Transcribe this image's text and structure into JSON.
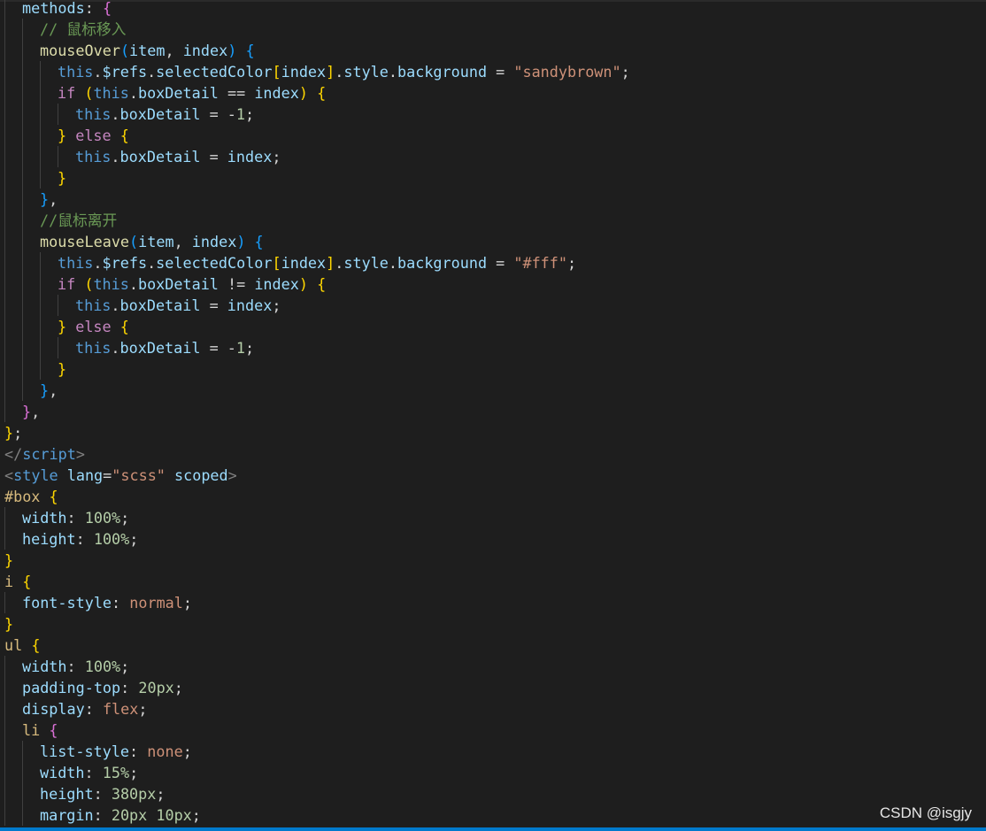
{
  "editor": {
    "language": "vue",
    "theme": "dark",
    "colors": {
      "background": "#1e1e1e",
      "default_text": "#d4d4d4",
      "keyword": "#c586c0",
      "this_keyword": "#569cd6",
      "function": "#dcdcaa",
      "property": "#9cdcfe",
      "string": "#ce9178",
      "number": "#b5cea8",
      "comment": "#6a9955",
      "selector": "#d7ba7d",
      "bracket_level1": "#ffd700",
      "bracket_level2": "#da70d6",
      "bracket_level3": "#179fff",
      "indent_guide": "#404040",
      "status_bar": "#007acc"
    },
    "lines": [
      {
        "indent": 1,
        "tokens": [
          [
            "prop",
            "methods"
          ],
          [
            "pun",
            ": "
          ],
          [
            "b2",
            "{"
          ]
        ]
      },
      {
        "indent": 2,
        "tokens": [
          [
            "cmt",
            "// 鼠标移入"
          ]
        ]
      },
      {
        "indent": 2,
        "tokens": [
          [
            "fn",
            "mouseOver"
          ],
          [
            "b3",
            "("
          ],
          [
            "prop",
            "item"
          ],
          [
            "pun",
            ", "
          ],
          [
            "prop",
            "index"
          ],
          [
            "b3",
            ")"
          ],
          [
            "pun",
            " "
          ],
          [
            "b3",
            "{"
          ]
        ]
      },
      {
        "indent": 3,
        "tokens": [
          [
            "kwb",
            "this"
          ],
          [
            "pun",
            "."
          ],
          [
            "prop",
            "$refs"
          ],
          [
            "pun",
            "."
          ],
          [
            "prop",
            "selectedColor"
          ],
          [
            "b1",
            "["
          ],
          [
            "prop",
            "index"
          ],
          [
            "b1",
            "]"
          ],
          [
            "pun",
            "."
          ],
          [
            "prop",
            "style"
          ],
          [
            "pun",
            "."
          ],
          [
            "prop",
            "background"
          ],
          [
            "pun",
            " = "
          ],
          [
            "str",
            "\"sandybrown\""
          ],
          [
            "pun",
            ";"
          ]
        ]
      },
      {
        "indent": 3,
        "tokens": [
          [
            "kw",
            "if"
          ],
          [
            "pun",
            " "
          ],
          [
            "b1",
            "("
          ],
          [
            "kwb",
            "this"
          ],
          [
            "pun",
            "."
          ],
          [
            "prop",
            "boxDetail"
          ],
          [
            "pun",
            " == "
          ],
          [
            "prop",
            "index"
          ],
          [
            "b1",
            ")"
          ],
          [
            "pun",
            " "
          ],
          [
            "b1",
            "{"
          ]
        ]
      },
      {
        "indent": 4,
        "tokens": [
          [
            "kwb",
            "this"
          ],
          [
            "pun",
            "."
          ],
          [
            "prop",
            "boxDetail"
          ],
          [
            "pun",
            " = "
          ],
          [
            "pun",
            "-"
          ],
          [
            "num",
            "1"
          ],
          [
            "pun",
            ";"
          ]
        ]
      },
      {
        "indent": 3,
        "tokens": [
          [
            "b1",
            "}"
          ],
          [
            "pun",
            " "
          ],
          [
            "kw",
            "else"
          ],
          [
            "pun",
            " "
          ],
          [
            "b1",
            "{"
          ]
        ]
      },
      {
        "indent": 4,
        "tokens": [
          [
            "kwb",
            "this"
          ],
          [
            "pun",
            "."
          ],
          [
            "prop",
            "boxDetail"
          ],
          [
            "pun",
            " = "
          ],
          [
            "prop",
            "index"
          ],
          [
            "pun",
            ";"
          ]
        ]
      },
      {
        "indent": 3,
        "tokens": [
          [
            "b1",
            "}"
          ]
        ]
      },
      {
        "indent": 2,
        "tokens": [
          [
            "b3",
            "}"
          ],
          [
            "pun",
            ","
          ]
        ]
      },
      {
        "indent": 2,
        "tokens": [
          [
            "cmt",
            "//鼠标离开"
          ]
        ]
      },
      {
        "indent": 2,
        "tokens": [
          [
            "fn",
            "mouseLeave"
          ],
          [
            "b3",
            "("
          ],
          [
            "prop",
            "item"
          ],
          [
            "pun",
            ", "
          ],
          [
            "prop",
            "index"
          ],
          [
            "b3",
            ")"
          ],
          [
            "pun",
            " "
          ],
          [
            "b3",
            "{"
          ]
        ]
      },
      {
        "indent": 3,
        "tokens": [
          [
            "kwb",
            "this"
          ],
          [
            "pun",
            "."
          ],
          [
            "prop",
            "$refs"
          ],
          [
            "pun",
            "."
          ],
          [
            "prop",
            "selectedColor"
          ],
          [
            "b1",
            "["
          ],
          [
            "prop",
            "index"
          ],
          [
            "b1",
            "]"
          ],
          [
            "pun",
            "."
          ],
          [
            "prop",
            "style"
          ],
          [
            "pun",
            "."
          ],
          [
            "prop",
            "background"
          ],
          [
            "pun",
            " = "
          ],
          [
            "str",
            "\"#fff\""
          ],
          [
            "pun",
            ";"
          ]
        ]
      },
      {
        "indent": 3,
        "tokens": [
          [
            "kw",
            "if"
          ],
          [
            "pun",
            " "
          ],
          [
            "b1",
            "("
          ],
          [
            "kwb",
            "this"
          ],
          [
            "pun",
            "."
          ],
          [
            "prop",
            "boxDetail"
          ],
          [
            "pun",
            " != "
          ],
          [
            "prop",
            "index"
          ],
          [
            "b1",
            ")"
          ],
          [
            "pun",
            " "
          ],
          [
            "b1",
            "{"
          ]
        ]
      },
      {
        "indent": 4,
        "tokens": [
          [
            "kwb",
            "this"
          ],
          [
            "pun",
            "."
          ],
          [
            "prop",
            "boxDetail"
          ],
          [
            "pun",
            " = "
          ],
          [
            "prop",
            "index"
          ],
          [
            "pun",
            ";"
          ]
        ]
      },
      {
        "indent": 3,
        "tokens": [
          [
            "b1",
            "}"
          ],
          [
            "pun",
            " "
          ],
          [
            "kw",
            "else"
          ],
          [
            "pun",
            " "
          ],
          [
            "b1",
            "{"
          ]
        ]
      },
      {
        "indent": 4,
        "tokens": [
          [
            "kwb",
            "this"
          ],
          [
            "pun",
            "."
          ],
          [
            "prop",
            "boxDetail"
          ],
          [
            "pun",
            " = "
          ],
          [
            "pun",
            "-"
          ],
          [
            "num",
            "1"
          ],
          [
            "pun",
            ";"
          ]
        ]
      },
      {
        "indent": 3,
        "tokens": [
          [
            "b1",
            "}"
          ]
        ]
      },
      {
        "indent": 2,
        "tokens": [
          [
            "b3",
            "}"
          ],
          [
            "pun",
            ","
          ]
        ]
      },
      {
        "indent": 1,
        "tokens": [
          [
            "b2",
            "}"
          ],
          [
            "pun",
            ","
          ]
        ]
      },
      {
        "indent": 0,
        "tokens": [
          [
            "b1",
            "}"
          ],
          [
            "pun",
            ";"
          ]
        ]
      },
      {
        "indent": 0,
        "tokens": [
          [
            "ang",
            "</"
          ],
          [
            "tag",
            "script"
          ],
          [
            "ang",
            ">"
          ]
        ]
      },
      {
        "indent": 0,
        "tokens": [
          [
            "ang",
            "<"
          ],
          [
            "tag",
            "style"
          ],
          [
            "pun",
            " "
          ],
          [
            "attr",
            "lang"
          ],
          [
            "pun",
            "="
          ],
          [
            "str",
            "\"scss\""
          ],
          [
            "pun",
            " "
          ],
          [
            "attr",
            "scoped"
          ],
          [
            "ang",
            ">"
          ]
        ]
      },
      {
        "indent": 0,
        "tokens": [
          [
            "sel",
            "#box"
          ],
          [
            "pun",
            " "
          ],
          [
            "b1",
            "{"
          ]
        ]
      },
      {
        "indent": 1,
        "tokens": [
          [
            "prop",
            "width"
          ],
          [
            "pun",
            ": "
          ],
          [
            "num",
            "100%"
          ],
          [
            "pun",
            ";"
          ]
        ]
      },
      {
        "indent": 1,
        "tokens": [
          [
            "prop",
            "height"
          ],
          [
            "pun",
            ": "
          ],
          [
            "num",
            "100%"
          ],
          [
            "pun",
            ";"
          ]
        ]
      },
      {
        "indent": 0,
        "tokens": [
          [
            "b1",
            "}"
          ]
        ]
      },
      {
        "indent": 0,
        "tokens": [
          [
            "sel",
            "i"
          ],
          [
            "pun",
            " "
          ],
          [
            "b1",
            "{"
          ]
        ]
      },
      {
        "indent": 1,
        "tokens": [
          [
            "prop",
            "font-style"
          ],
          [
            "pun",
            ": "
          ],
          [
            "str",
            "normal"
          ],
          [
            "pun",
            ";"
          ]
        ]
      },
      {
        "indent": 0,
        "tokens": [
          [
            "b1",
            "}"
          ]
        ]
      },
      {
        "indent": 0,
        "tokens": [
          [
            "sel",
            "ul"
          ],
          [
            "pun",
            " "
          ],
          [
            "b1",
            "{"
          ]
        ]
      },
      {
        "indent": 1,
        "tokens": [
          [
            "prop",
            "width"
          ],
          [
            "pun",
            ": "
          ],
          [
            "num",
            "100%"
          ],
          [
            "pun",
            ";"
          ]
        ]
      },
      {
        "indent": 1,
        "tokens": [
          [
            "prop",
            "padding-top"
          ],
          [
            "pun",
            ": "
          ],
          [
            "num",
            "20px"
          ],
          [
            "pun",
            ";"
          ]
        ]
      },
      {
        "indent": 1,
        "tokens": [
          [
            "prop",
            "display"
          ],
          [
            "pun",
            ": "
          ],
          [
            "str",
            "flex"
          ],
          [
            "pun",
            ";"
          ]
        ]
      },
      {
        "indent": 1,
        "tokens": [
          [
            "sel",
            "li"
          ],
          [
            "pun",
            " "
          ],
          [
            "b2",
            "{"
          ]
        ]
      },
      {
        "indent": 2,
        "tokens": [
          [
            "prop",
            "list-style"
          ],
          [
            "pun",
            ": "
          ],
          [
            "str",
            "none"
          ],
          [
            "pun",
            ";"
          ]
        ]
      },
      {
        "indent": 2,
        "tokens": [
          [
            "prop",
            "width"
          ],
          [
            "pun",
            ": "
          ],
          [
            "num",
            "15%"
          ],
          [
            "pun",
            ";"
          ]
        ]
      },
      {
        "indent": 2,
        "tokens": [
          [
            "prop",
            "height"
          ],
          [
            "pun",
            ": "
          ],
          [
            "num",
            "380px"
          ],
          [
            "pun",
            ";"
          ]
        ]
      },
      {
        "indent": 2,
        "tokens": [
          [
            "prop",
            "margin"
          ],
          [
            "pun",
            ": "
          ],
          [
            "num",
            "20px"
          ],
          [
            "pun",
            " "
          ],
          [
            "num",
            "10px"
          ],
          [
            "pun",
            ";"
          ]
        ]
      }
    ]
  },
  "watermark": {
    "text": "CSDN @isgjy"
  }
}
